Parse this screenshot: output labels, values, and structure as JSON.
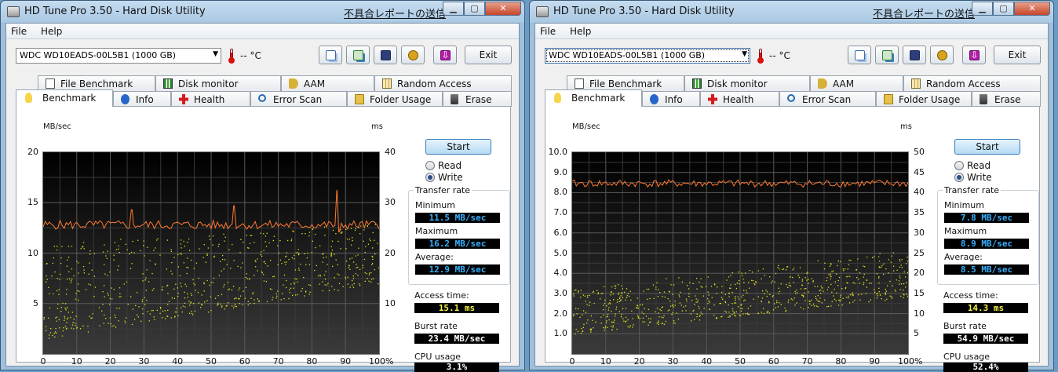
{
  "windows": [
    {
      "title": "HD Tune Pro 3.50 - Hard Disk Utility",
      "report_link": "不具合レポートの送信",
      "menu": [
        "File",
        "Help"
      ],
      "drive": "WDC WD10EADS-00L5B1 (1000 GB)",
      "temperature": "-- °C",
      "exit_label": "Exit",
      "tabs_top": [
        "File Benchmark",
        "Disk monitor",
        "AAM",
        "Random Access"
      ],
      "tabs_bottom": [
        "Benchmark",
        "Info",
        "Health",
        "Error Scan",
        "Folder Usage",
        "Erase"
      ],
      "active_tab": "Benchmark",
      "start_label": "Start",
      "mode_options": [
        "Read",
        "Write"
      ],
      "mode_selected": "Write",
      "transfer_rate_title": "Transfer rate",
      "minimum_label": "Minimum",
      "minimum": "11.5 MB/sec",
      "maximum_label": "Maximum",
      "maximum": "16.2 MB/sec",
      "average_label": "Average:",
      "average": "12.9 MB/sec",
      "access_time_label": "Access time:",
      "access_time": "15.1 ms",
      "burst_rate_label": "Burst rate",
      "burst_rate": "23.4 MB/sec",
      "cpu_usage_label": "CPU usage",
      "cpu_usage": "3.1%",
      "chart_data": {
        "type": "line",
        "ylabel": "MB/sec",
        "y2label": "ms",
        "ylim": [
          0,
          20
        ],
        "y2lim": [
          0,
          40
        ],
        "yticks": [
          "20",
          "15",
          "10",
          "5"
        ],
        "y2ticks": [
          "40",
          "30",
          "20",
          "10"
        ],
        "xticks": [
          "0",
          "10",
          "20",
          "30",
          "40",
          "50",
          "60",
          "70",
          "80",
          "90",
          "100%"
        ],
        "xlim": [
          0,
          100
        ],
        "grid": true,
        "series": [
          {
            "name": "Transfer rate",
            "color": "#ff7a30",
            "axis": "left",
            "baseline": 12.8,
            "noise": 0.45,
            "x": [
              0,
              26.5,
              56.7,
              87.4,
              88
            ],
            "y": [
              12.6,
              14.3,
              14.7,
              16.2,
              12.1
            ]
          },
          {
            "name": "Access time",
            "color": "#e5e520",
            "axis": "right",
            "type": "scatter",
            "cloud": {
              "x_from": 0,
              "x_to": 100,
              "y_low_start": 3,
              "y_high_start": 22,
              "y_low_end": 14,
              "y_high_end": 26,
              "points": 700
            }
          }
        ]
      }
    },
    {
      "title": "HD Tune Pro 3.50 - Hard Disk Utility",
      "report_link": "不具合レポートの送信",
      "menu": [
        "File",
        "Help"
      ],
      "drive": "WDC WD10EADS-00L5B1 (1000 GB)",
      "temperature": "-- °C",
      "exit_label": "Exit",
      "tabs_top": [
        "File Benchmark",
        "Disk monitor",
        "AAM",
        "Random Access"
      ],
      "tabs_bottom": [
        "Benchmark",
        "Info",
        "Health",
        "Error Scan",
        "Folder Usage",
        "Erase"
      ],
      "active_tab": "Benchmark",
      "start_label": "Start",
      "mode_options": [
        "Read",
        "Write"
      ],
      "mode_selected": "Write",
      "transfer_rate_title": "Transfer rate",
      "minimum_label": "Minimum",
      "minimum": "7.8 MB/sec",
      "maximum_label": "Maximum",
      "maximum": "8.9 MB/sec",
      "average_label": "Average:",
      "average": "8.5 MB/sec",
      "access_time_label": "Access time:",
      "access_time": "14.3 ms",
      "burst_rate_label": "Burst rate",
      "burst_rate": "54.9 MB/sec",
      "cpu_usage_label": "CPU usage",
      "cpu_usage": "52.4%",
      "chart_data": {
        "type": "line",
        "ylabel": "MB/sec",
        "y2label": "ms",
        "ylim": [
          0,
          10
        ],
        "y2lim": [
          0,
          50
        ],
        "yticks": [
          "10.0",
          "9.0",
          "8.0",
          "7.0",
          "6.0",
          "5.0",
          "4.0",
          "3.0",
          "2.0",
          "1.0"
        ],
        "y2ticks": [
          "50",
          "45",
          "40",
          "35",
          "30",
          "25",
          "20",
          "15",
          "10",
          "5"
        ],
        "xticks": [
          "0",
          "10",
          "20",
          "30",
          "40",
          "50",
          "60",
          "70",
          "80",
          "90",
          "100%"
        ],
        "xlim": [
          0,
          100
        ],
        "grid": true,
        "series": [
          {
            "name": "Transfer rate",
            "color": "#ff7a30",
            "axis": "left",
            "baseline": 8.45,
            "noise": 0.18,
            "x": [],
            "y": []
          },
          {
            "name": "Access time",
            "color": "#e5e520",
            "axis": "right",
            "type": "scatter",
            "cloud": {
              "x_from": 0,
              "x_to": 100,
              "y_low_start": 5,
              "y_high_start": 16,
              "y_low_end": 14,
              "y_high_end": 26,
              "points": 700
            }
          }
        ]
      }
    }
  ]
}
